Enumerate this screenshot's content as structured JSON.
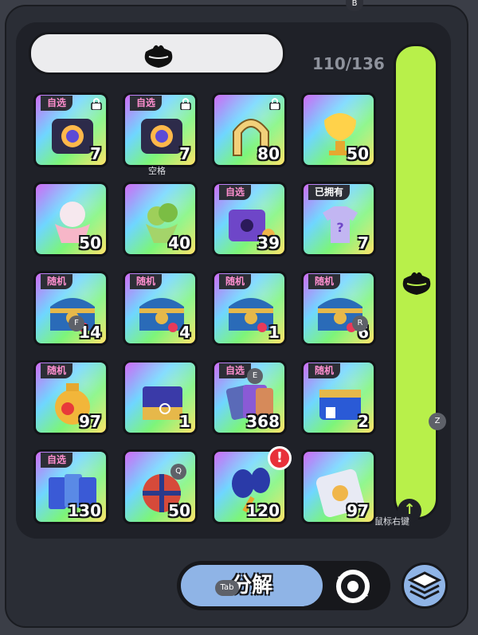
{
  "window": {
    "top_hotkey": "B"
  },
  "search": {
    "icon": "bag-icon"
  },
  "inventory": {
    "count_text": "110/136"
  },
  "side_panel": {
    "icon": "bag-icon",
    "hint": "鼠标右键",
    "hotkey": "Z"
  },
  "space_hint": "空格",
  "items": [
    {
      "tag": "自选",
      "qty": "7",
      "locked": true,
      "art": "chest-dark"
    },
    {
      "tag": "自选",
      "qty": "7",
      "locked": true,
      "art": "chest-dark"
    },
    {
      "tag": "",
      "qty": "80",
      "locked": true,
      "art": "horseshoe"
    },
    {
      "tag": "",
      "qty": "50",
      "locked": false,
      "art": "golden-cup"
    },
    {
      "tag": "",
      "qty": "50",
      "locked": false,
      "art": "ice-cream"
    },
    {
      "tag": "",
      "qty": "40",
      "locked": false,
      "art": "green-cup"
    },
    {
      "tag": "自选",
      "qty": "39",
      "locked": false,
      "art": "purple-box"
    },
    {
      "tag": "已拥有",
      "qty": "7",
      "locked": false,
      "art": "tshirt"
    },
    {
      "tag": "随机",
      "qty": "14",
      "locked": false,
      "art": "treasure-chest",
      "hotkey": "F"
    },
    {
      "tag": "随机",
      "qty": "4",
      "locked": false,
      "art": "treasure-chest"
    },
    {
      "tag": "随机",
      "qty": "1",
      "locked": false,
      "art": "treasure-chest"
    },
    {
      "tag": "随机",
      "qty": "6",
      "locked": false,
      "art": "treasure-chest",
      "hotkey": "R"
    },
    {
      "tag": "随机",
      "qty": "97",
      "locked": false,
      "art": "gold-pot"
    },
    {
      "tag": "",
      "qty": "1",
      "locked": false,
      "art": "gift-box"
    },
    {
      "tag": "自选",
      "qty": "368",
      "locked": false,
      "art": "cards",
      "hotkey": "E"
    },
    {
      "tag": "随机",
      "qty": "2",
      "locked": false,
      "art": "blue-chest"
    },
    {
      "tag": "自选",
      "qty": "130",
      "locked": false,
      "art": "tickets"
    },
    {
      "tag": "",
      "qty": "50",
      "locked": false,
      "art": "ball",
      "hotkey": "Q"
    },
    {
      "tag": "",
      "qty": "120",
      "locked": false,
      "art": "maracas",
      "alert": "!"
    },
    {
      "tag": "",
      "qty": "97",
      "locked": false,
      "art": "sticker"
    }
  ],
  "actions": {
    "decompose_label": "分解",
    "tab_hotkey": "Tab",
    "refresh_icon": "refresh-gear-icon",
    "layers_icon": "layers-icon"
  },
  "colors": {
    "accent_green": "#b8f04a",
    "button_blue": "#8fb4e6",
    "tag_pink": "#ff8fcf",
    "alert_red": "#e8303a"
  }
}
